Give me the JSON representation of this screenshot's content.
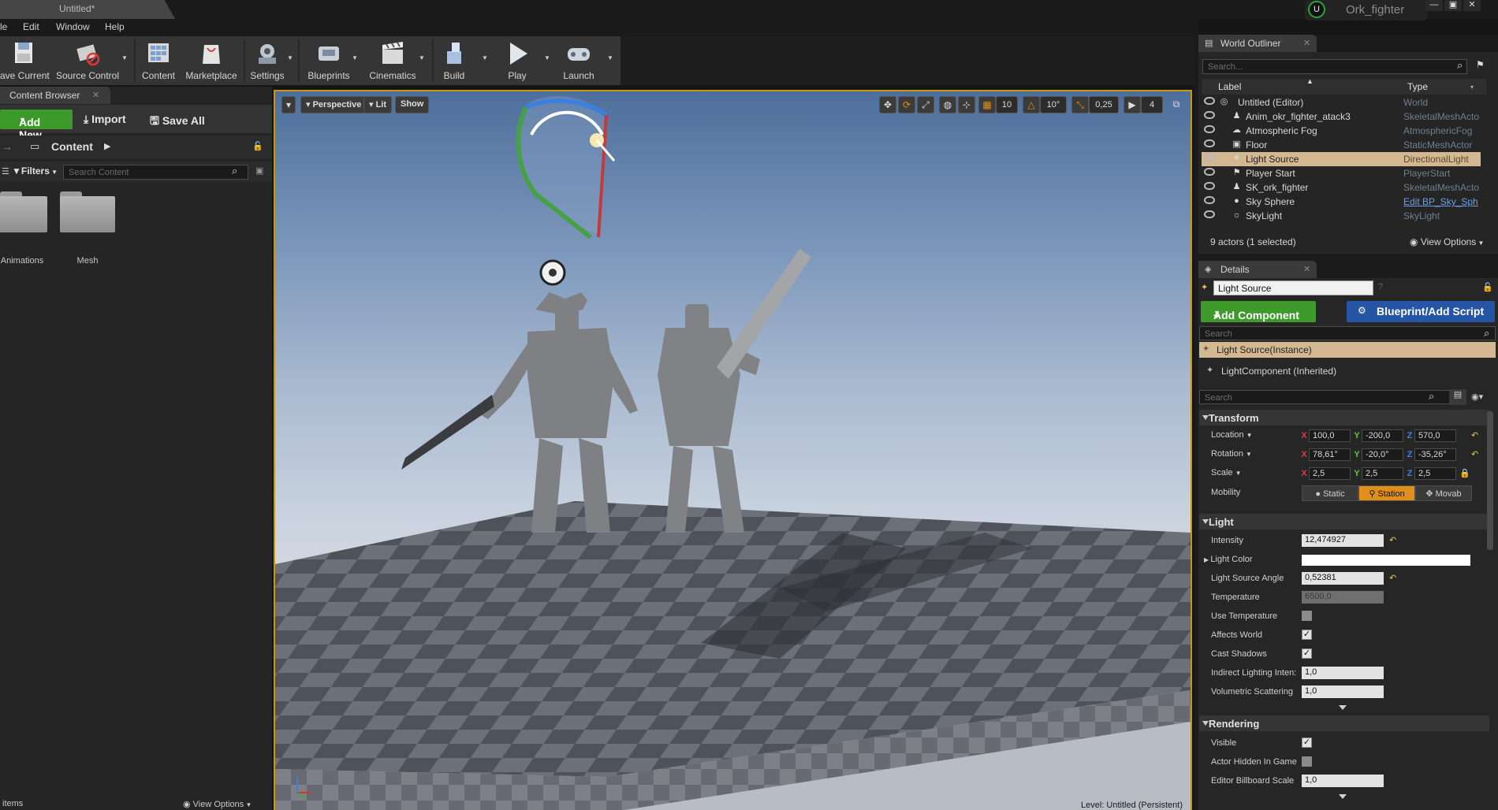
{
  "titlebar": {
    "doc_tab": "Untitled*",
    "project_name": "Ork_fighter",
    "min": "—",
    "max": "▣",
    "close": "✕"
  },
  "menu": [
    "le",
    "Edit",
    "Window",
    "Help"
  ],
  "toolbar": [
    {
      "label": "ave Current",
      "icon": "save-icon"
    },
    {
      "label": "Source Control",
      "icon": "source-control-icon"
    },
    {
      "label": "Content",
      "icon": "content-icon"
    },
    {
      "label": "Marketplace",
      "icon": "marketplace-icon"
    },
    {
      "label": "Settings",
      "icon": "settings-icon"
    },
    {
      "label": "Blueprints",
      "icon": "blueprints-icon"
    },
    {
      "label": "Cinematics",
      "icon": "cinematics-icon"
    },
    {
      "label": "Build",
      "icon": "build-icon"
    },
    {
      "label": "Play",
      "icon": "play-icon"
    },
    {
      "label": "Launch",
      "icon": "launch-icon"
    }
  ],
  "content_browser": {
    "tab": "Content Browser",
    "add_new": "Add New",
    "import": "Import",
    "save_all": "Save All",
    "path": "Content",
    "filters": "Filters",
    "search_placeholder": "Search Content",
    "folders": [
      "Animations",
      "Mesh"
    ],
    "footer_items": "items",
    "view_options": "View Options"
  },
  "viewport": {
    "perspective": "Perspective",
    "lit": "Lit",
    "show": "Show",
    "grid_snap": "10",
    "rot_snap": "10°",
    "scale_snap": "0,25",
    "cam_speed": "4",
    "level_text": "Level:  Untitled (Persistent)"
  },
  "world_outliner": {
    "tab": "World Outliner",
    "search_placeholder": "Search...",
    "col_label": "Label",
    "col_type": "Type",
    "rows": [
      {
        "label": "Untitled (Editor)",
        "type": "World",
        "icon": "world-icon",
        "indent": 0
      },
      {
        "label": "Anim_okr_fighter_atack3",
        "type": "SkeletalMeshActo",
        "icon": "skeletal-mesh-icon",
        "indent": 1
      },
      {
        "label": "Atmospheric Fog",
        "type": "AtmosphericFog",
        "icon": "fog-icon",
        "indent": 1
      },
      {
        "label": "Floor",
        "type": "StaticMeshActor",
        "icon": "static-mesh-icon",
        "indent": 1
      },
      {
        "label": "Light Source",
        "type": "DirectionalLight",
        "icon": "directional-light-icon",
        "indent": 1,
        "selected": true
      },
      {
        "label": "Player Start",
        "type": "PlayerStart",
        "icon": "player-start-icon",
        "indent": 1
      },
      {
        "label": "SK_ork_fighter",
        "type": "SkeletalMeshActo",
        "icon": "skeletal-mesh-icon",
        "indent": 1
      },
      {
        "label": "Sky Sphere",
        "type": "Edit BP_Sky_Sph",
        "icon": "sphere-icon",
        "indent": 1
      },
      {
        "label": "SkyLight",
        "type": "SkyLight",
        "icon": "skylight-icon",
        "indent": 1
      }
    ],
    "footer": "9 actors (1 selected)",
    "view_options": "View Options"
  },
  "details": {
    "tab": "Details",
    "actor_name": "Light Source",
    "add_component": "Add Component",
    "blueprint_script": "Blueprint/Add Script",
    "search_placeholder": "Search",
    "component_selected": "Light Source(Instance)",
    "component_inherited": "LightComponent (Inherited)",
    "search2_placeholder": "Search",
    "transform": {
      "title": "Transform",
      "location_label": "Location",
      "rotation_label": "Rotation",
      "scale_label": "Scale",
      "mobility_label": "Mobility",
      "location": [
        "100,0",
        "-200,0",
        "570,0"
      ],
      "rotation": [
        "78,61°",
        "-20,0°",
        "-35,26°"
      ],
      "scale": [
        "2,5",
        "2,5",
        "2,5"
      ],
      "mobility": [
        "Static",
        "Station",
        "Movab"
      ]
    },
    "light": {
      "title": "Light",
      "intensity_label": "Intensity",
      "intensity": "12,474927",
      "light_color_label": "Light Color",
      "angle_label": "Light Source Angle",
      "angle": "0,52381",
      "temperature_label": "Temperature",
      "temperature": "6500,0",
      "use_temp_label": "Use Temperature",
      "affects_world_label": "Affects World",
      "cast_shadows_label": "Cast Shadows",
      "indirect_label": "Indirect Lighting Inten:",
      "indirect": "1,0",
      "volumetric_label": "Volumetric Scattering",
      "volumetric": "1,0"
    },
    "rendering": {
      "title": "Rendering",
      "visible_label": "Visible",
      "hidden_label": "Actor Hidden In Game",
      "billboard_label": "Editor Billboard Scale",
      "billboard": "1,0"
    }
  },
  "colors": {
    "accent_green": "#3f9a2c",
    "accent_blue": "#2755a6",
    "selection": "#d4b891",
    "viewport_border": "#c9960c"
  }
}
